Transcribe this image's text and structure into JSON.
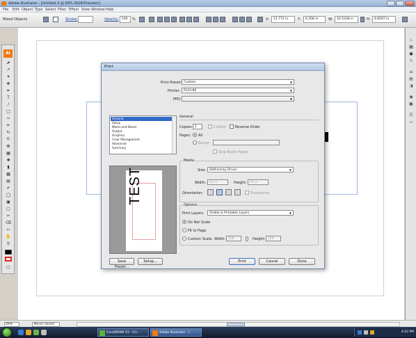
{
  "window": {
    "title": "Adobe Illustrator - [Untitled-3 @ 69% (RGB/Preview)]"
  },
  "menubar": {
    "items": [
      "File",
      "Edit",
      "Object",
      "Type",
      "Select",
      "Filter",
      "Effect",
      "View",
      "Window",
      "Help"
    ]
  },
  "controlbar": {
    "selection_label": "Mixed Objects",
    "stroke_label": "Stroke:",
    "opacity_label": "Opacity:",
    "opacity_value": "100",
    "opacity_unit": "%",
    "x_label": "X:",
    "x_value": "12.772 in",
    "y_label": "Y:",
    "y_value": "6.208 in",
    "w_label": "W:",
    "w_value": "16.5338 in",
    "h_label": "H:",
    "h_value": "8.8597 in"
  },
  "statusbar": {
    "zoom": "69%",
    "state": "Never Saved"
  },
  "taskbar": {
    "tasks": [
      "CorelDRAW X3 - [Gr...",
      "Adobe Illustrator - [..."
    ],
    "clock": "4:02 PM"
  },
  "dialog": {
    "title": "Print",
    "print_preset_label": "Print Preset:",
    "print_preset_value": "Custom",
    "printer_label": "Printer:",
    "printer_value": "PLS3-80",
    "ppd_label": "PPD:",
    "ppd_value": "",
    "categories": [
      "General",
      "Setup",
      "Marks and Bleed",
      "Output",
      "Graphics",
      "Color Management",
      "Advanced",
      "Summary"
    ],
    "selected_category": "General",
    "general_heading": "General",
    "copies_label": "Copies:",
    "copies_value": "1",
    "collate_label": "Collate",
    "reverse_order_label": "Reverse Order",
    "pages_label": "Pages:",
    "all_label": "All",
    "range_label": "Range:",
    "range_value": "",
    "skip_blank_label": "Skip Blank Pages",
    "media_heading": "Media",
    "size_label": "Size:",
    "size_value": "Defined by Driver",
    "width_label": "Width:",
    "width_value": "12 in",
    "height_label": "Height:",
    "height_value": "24 in",
    "orientation_label": "Orientation:",
    "transverse_label": "Transverse",
    "options_heading": "Options",
    "print_layers_label": "Print Layers:",
    "print_layers_value": "Visible & Printable Layers",
    "do_not_scale_label": "Do Not Scale",
    "fit_to_page_label": "Fit to Page",
    "custom_scale_label": "Custom Scale:",
    "scale_width_label": "Width:",
    "scale_width_value": "100",
    "scale_height_label": "Height:",
    "scale_height_value": "100",
    "preview_text": "TEST",
    "save_preset_label": "Save Preset...",
    "setup_label": "Setup...",
    "print_label": "Print",
    "cancel_label": "Cancel",
    "done_label": "Done"
  },
  "colors": {
    "accent": "#3169c6",
    "ai_orange": "#ef7a16",
    "taskbar": "#10192b"
  }
}
